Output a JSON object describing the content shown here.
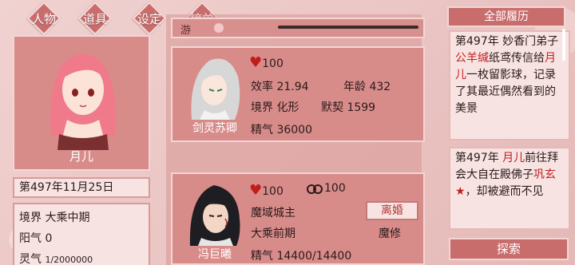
{
  "tabs": [
    {
      "label": "人物"
    },
    {
      "label": "道具"
    },
    {
      "label": "设定"
    },
    {
      "label": "榜单"
    }
  ],
  "player": {
    "name": "月儿",
    "date": "第497年11月25日",
    "realm_label": "境界",
    "realm": "大乘中期",
    "yang_label": "阳气",
    "yang": "0",
    "spirit_label": "灵气",
    "spirit": "1/2000000"
  },
  "speed": {
    "label": "游"
  },
  "cards": [
    {
      "name": "剑灵苏卿",
      "affection": "100",
      "efficiency_label": "效率",
      "efficiency": "21.94",
      "age_label": "年龄",
      "age": "432",
      "realm_label": "境界",
      "realm": "化形",
      "tacit_label": "默契",
      "tacit": "1599",
      "essence_label": "精气",
      "essence": "36000"
    },
    {
      "name": "冯巨曦",
      "affection": "100",
      "bond": "100",
      "title": "魔域城主",
      "divorce_label": "离婚",
      "realm": "大乘前期",
      "path": "魔修",
      "essence_label": "精气",
      "essence": "14400/14400"
    }
  ],
  "history": {
    "header": "全部履历",
    "items": [
      {
        "p1": "第497年 妙香门弟子",
        "hl": "公羊缄",
        "p2": "纸鸢传信给",
        "hl2": "月儿",
        "p3": "一枚留影球，记录了其最近偶然看到的美景"
      },
      {
        "p1": "第497年 ",
        "hl": "月儿",
        "p2": "前往拜会大自在殿佛子",
        "hl2": "巩玄",
        "star": "★",
        "p3": "，却被避而不见"
      }
    ],
    "search_label": "探索"
  },
  "colors": {
    "accent": "#c96c6c",
    "heart": "#c21d1d",
    "highlight": "#c21d1d"
  }
}
